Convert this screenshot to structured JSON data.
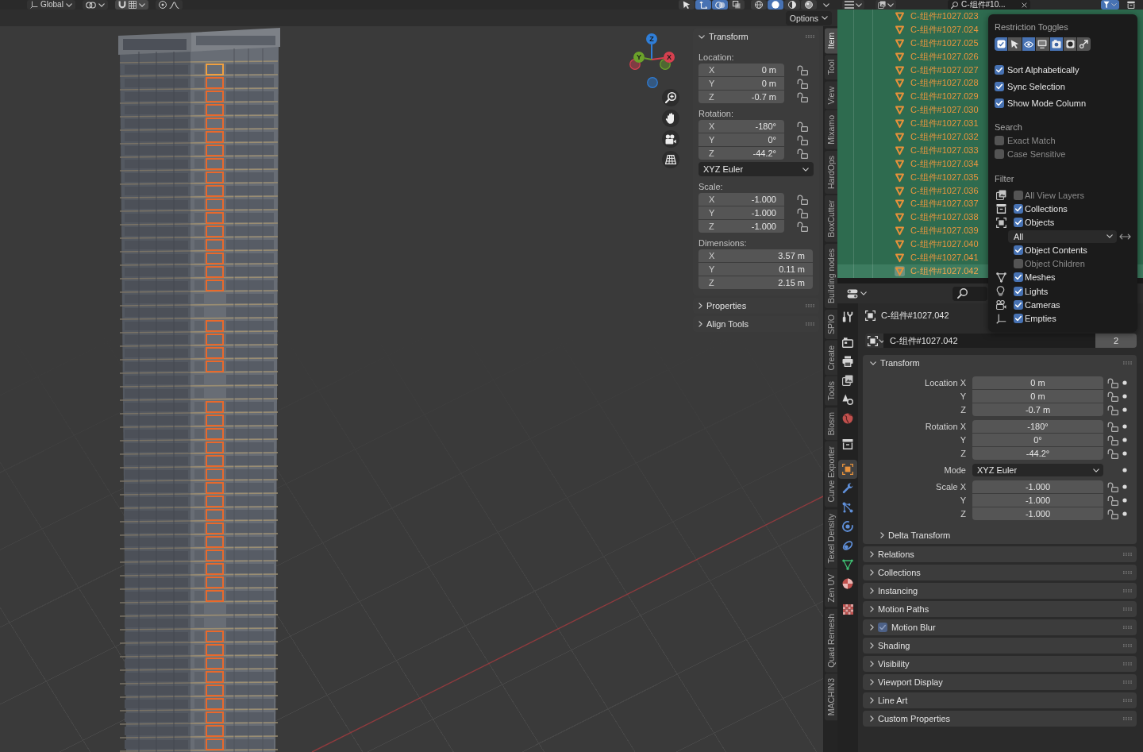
{
  "top_bar": {
    "orientation": "Global",
    "header_toggles": [
      {
        "on": false
      },
      {
        "on": true
      },
      {
        "on": true
      },
      {
        "on": false
      }
    ],
    "shading_modes": [
      {
        "selected": false
      },
      {
        "selected": true
      },
      {
        "selected": false
      },
      {
        "selected": false
      }
    ]
  },
  "viewport": {
    "options": "Options",
    "gizmo_axes": [
      {
        "label": "Z",
        "color": "#2f7ed8"
      },
      {
        "label": "Y",
        "color": "#6ba22a"
      },
      {
        "label": "X",
        "color": "#d6404f"
      }
    ]
  },
  "sidebar": {
    "tabs": [
      {
        "label": "Item",
        "selected": true
      },
      {
        "label": "Tool",
        "selected": false
      },
      {
        "label": "View",
        "selected": false
      },
      {
        "label": "Mixamo",
        "selected": false
      },
      {
        "label": "HardOps",
        "selected": false
      },
      {
        "label": "BoxCutter",
        "selected": false
      },
      {
        "label": "Building nodes",
        "selected": false
      },
      {
        "label": "SPIO",
        "selected": false
      },
      {
        "label": "Create",
        "selected": false
      },
      {
        "label": "Tools",
        "selected": false
      },
      {
        "label": "Blosm",
        "selected": false
      },
      {
        "label": "Curve Exporter",
        "selected": false
      },
      {
        "label": "Texel Density",
        "selected": false
      },
      {
        "label": "Zen UV",
        "selected": false
      },
      {
        "label": "Quad Remesh",
        "selected": false
      },
      {
        "label": "MACHIN3",
        "selected": false
      }
    ],
    "transform": {
      "title": "Transform",
      "expanded": true,
      "rows": [
        {
          "kind": "group",
          "label": "Location:",
          "fields": [
            {
              "axis": "X",
              "value": "0 m"
            },
            {
              "axis": "Y",
              "value": "0 m"
            },
            {
              "axis": "Z",
              "value": "-0.7 m"
            }
          ],
          "locks": [
            {
              "locked": false
            },
            {
              "locked": false
            },
            {
              "locked": false
            }
          ]
        },
        {
          "kind": "group",
          "label": "Rotation:",
          "fields": [
            {
              "axis": "X",
              "value": "-180°"
            },
            {
              "axis": "Y",
              "value": "0°"
            },
            {
              "axis": "Z",
              "value": "-44.2°"
            }
          ],
          "locks": [
            {
              "locked": false
            },
            {
              "locked": false
            },
            {
              "locked": false
            }
          ]
        },
        {
          "kind": "dropdown",
          "value": "XYZ Euler"
        },
        {
          "kind": "group",
          "label": "Scale:",
          "fields": [
            {
              "axis": "X",
              "value": "-1.000"
            },
            {
              "axis": "Y",
              "value": "-1.000"
            },
            {
              "axis": "Z",
              "value": "-1.000"
            }
          ],
          "locks": [
            {
              "locked": false
            },
            {
              "locked": false
            },
            {
              "locked": false
            }
          ]
        },
        {
          "kind": "group",
          "label": "Dimensions:",
          "fields": [
            {
              "axis": "X",
              "value": "3.57 m"
            },
            {
              "axis": "Y",
              "value": "0.11 m"
            },
            {
              "axis": "Z",
              "value": "2.15 m"
            }
          ]
        }
      ]
    },
    "panels": [
      {
        "title": "Properties",
        "expanded": false
      },
      {
        "title": "Align Tools",
        "expanded": false
      }
    ]
  },
  "outliner": {
    "search": "C-组件#10...",
    "rows": [
      {
        "name": "C-组件#1027.023",
        "selected": true,
        "active": false
      },
      {
        "name": "C-组件#1027.024",
        "selected": true,
        "active": false
      },
      {
        "name": "C-组件#1027.025",
        "selected": true,
        "active": false
      },
      {
        "name": "C-组件#1027.026",
        "selected": true,
        "active": false
      },
      {
        "name": "C-组件#1027.027",
        "selected": true,
        "active": false
      },
      {
        "name": "C-组件#1027.028",
        "selected": true,
        "active": false
      },
      {
        "name": "C-组件#1027.029",
        "selected": true,
        "active": false
      },
      {
        "name": "C-组件#1027.030",
        "selected": true,
        "active": false
      },
      {
        "name": "C-组件#1027.031",
        "selected": true,
        "active": false
      },
      {
        "name": "C-组件#1027.032",
        "selected": true,
        "active": false
      },
      {
        "name": "C-组件#1027.033",
        "selected": true,
        "active": false
      },
      {
        "name": "C-组件#1027.034",
        "selected": true,
        "active": false
      },
      {
        "name": "C-组件#1027.035",
        "selected": true,
        "active": false
      },
      {
        "name": "C-组件#1027.036",
        "selected": true,
        "active": false
      },
      {
        "name": "C-组件#1027.037",
        "selected": true,
        "active": false
      },
      {
        "name": "C-组件#1027.038",
        "selected": true,
        "active": false
      },
      {
        "name": "C-组件#1027.039",
        "selected": true,
        "active": false
      },
      {
        "name": "C-组件#1027.040",
        "selected": true,
        "active": false
      },
      {
        "name": "C-组件#1027.041",
        "selected": true,
        "active": false
      },
      {
        "name": "C-组件#1027.042",
        "selected": true,
        "active": true
      }
    ],
    "filter_popover": {
      "restriction_toggles": {
        "title": "Restriction Toggles",
        "toggles": [
          {
            "on": true
          },
          {
            "on": false
          },
          {
            "on": true
          },
          {
            "on": false
          },
          {
            "on": true
          },
          {
            "on": false
          },
          {
            "on": false
          }
        ]
      },
      "options": [
        {
          "label": "Sort Alphabetically",
          "checked": true
        },
        {
          "label": "Sync Selection",
          "checked": true
        },
        {
          "label": "Show Mode Column",
          "checked": true
        }
      ],
      "search": {
        "title": "Search",
        "options": [
          {
            "label": "Exact Match",
            "checked": false
          },
          {
            "label": "Case Sensitive",
            "checked": false
          }
        ]
      },
      "filter": {
        "title": "Filter",
        "items": [
          {
            "label": "All View Layers",
            "checked": false
          },
          {
            "label": "Collections",
            "checked": true
          },
          {
            "label": "Objects",
            "checked": true,
            "dropdown": "All",
            "children": [
              {
                "label": "Object Contents",
                "checked": true
              },
              {
                "label": "Object Children",
                "checked": false
              }
            ]
          },
          {
            "label": "Meshes",
            "checked": true
          },
          {
            "label": "Lights",
            "checked": true
          },
          {
            "label": "Cameras",
            "checked": true
          },
          {
            "label": "Empties",
            "checked": true
          }
        ]
      }
    }
  },
  "properties": {
    "tab_groups": [
      {
        "tabs": [
          {
            "selected": false
          }
        ]
      },
      {
        "tabs": [
          {
            "selected": false
          },
          {
            "selected": false
          },
          {
            "selected": false
          },
          {
            "selected": false
          },
          {
            "selected": false
          }
        ]
      },
      {
        "tabs": [
          {
            "selected": false
          }
        ]
      },
      {
        "tabs": [
          {
            "selected": true
          },
          {
            "selected": false
          },
          {
            "selected": false
          },
          {
            "selected": false
          },
          {
            "selected": false
          },
          {
            "selected": false
          },
          {
            "selected": false
          }
        ]
      },
      {
        "tabs": [
          {
            "selected": false
          }
        ]
      }
    ],
    "object_name": "C-组件#1027.042",
    "datablock": {
      "name": "C-组件#1027.042",
      "users": "2"
    },
    "transform": {
      "title": "Transform",
      "expanded": true,
      "groups": [
        {
          "fields": [
            {
              "kind": "number",
              "label": "Location X",
              "value": "0 m"
            },
            {
              "kind": "number",
              "label": "Y",
              "value": "0 m"
            },
            {
              "kind": "number",
              "label": "Z",
              "value": "-0.7 m"
            }
          ],
          "locks": [
            {
              "locked": false
            },
            {
              "locked": false
            },
            {
              "locked": false
            }
          ]
        },
        {
          "fields": [
            {
              "kind": "number",
              "label": "Rotation X",
              "value": "-180°"
            },
            {
              "kind": "number",
              "label": "Y",
              "value": "0°"
            },
            {
              "kind": "number",
              "label": "Z",
              "value": "-44.2°"
            }
          ],
          "locks": [
            {
              "locked": false
            },
            {
              "locked": false
            },
            {
              "locked": false
            }
          ]
        },
        {
          "fields": [
            {
              "kind": "dropdown",
              "label": "Mode",
              "value": "XYZ Euler"
            }
          ]
        },
        {
          "fields": [
            {
              "kind": "number",
              "label": "Scale X",
              "value": "-1.000"
            },
            {
              "kind": "number",
              "label": "Y",
              "value": "-1.000"
            },
            {
              "kind": "number",
              "label": "Z",
              "value": "-1.000"
            }
          ],
          "locks": [
            {
              "locked": false
            },
            {
              "locked": false
            },
            {
              "locked": false
            }
          ]
        }
      ],
      "subpanels": [
        {
          "title": "Delta Transform",
          "expanded": false
        }
      ]
    },
    "panels": [
      {
        "title": "Relations",
        "expanded": false
      },
      {
        "title": "Collections",
        "expanded": false
      },
      {
        "title": "Instancing",
        "expanded": false
      },
      {
        "title": "Motion Paths",
        "expanded": false
      },
      {
        "title": "Motion Blur",
        "expanded": false,
        "toggle": {
          "checked": true
        }
      },
      {
        "title": "Shading",
        "expanded": false
      },
      {
        "title": "Visibility",
        "expanded": false
      },
      {
        "title": "Viewport Display",
        "expanded": false
      },
      {
        "title": "Line Art",
        "expanded": false
      },
      {
        "title": "Custom Properties",
        "expanded": false
      }
    ]
  }
}
